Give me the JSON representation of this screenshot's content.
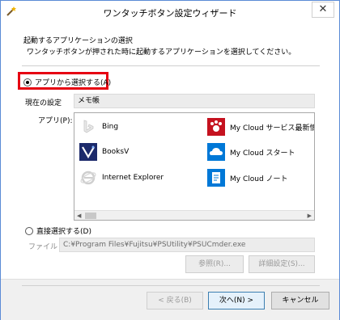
{
  "window": {
    "title": "ワンタッチボタン設定ウィザード",
    "close_glyph": "✕"
  },
  "header": {
    "heading": "起動するアプリケーションの選択",
    "description": "ワンタッチボタンが押された時に起動するアプリケーションを選択してください。"
  },
  "option_app": {
    "label": "アプリから選択する(A)",
    "selected": true
  },
  "current": {
    "label": "現在の設定",
    "value": "メモ帳"
  },
  "app_list": {
    "label": "アプリ(P):",
    "items": [
      {
        "name": "Bing",
        "icon": "bing-icon"
      },
      {
        "name": "My Cloud サービス最新情報",
        "icon": "my-cloud-news-icon"
      },
      {
        "name": "BooksV",
        "icon": "booksv-icon"
      },
      {
        "name": "My Cloud スタート",
        "icon": "my-cloud-start-icon"
      },
      {
        "name": "Internet Explorer",
        "icon": "internet-explorer-icon"
      },
      {
        "name": "My Cloud ノート",
        "icon": "my-cloud-note-icon"
      }
    ]
  },
  "option_direct": {
    "label": "直接選択する(D)",
    "selected": false
  },
  "file": {
    "label": "ファイル",
    "path": "C:¥Program Files¥Fujitsu¥PSUtility¥PSUCmder.exe"
  },
  "buttons": {
    "browse": "参照(R)...",
    "advanced": "詳細設定(S)...",
    "back": "< 戻る(B)",
    "next": "次へ(N) >",
    "cancel": "キャンセル"
  },
  "colors": {
    "highlight": "#e60012",
    "accent": "#0078d7"
  }
}
